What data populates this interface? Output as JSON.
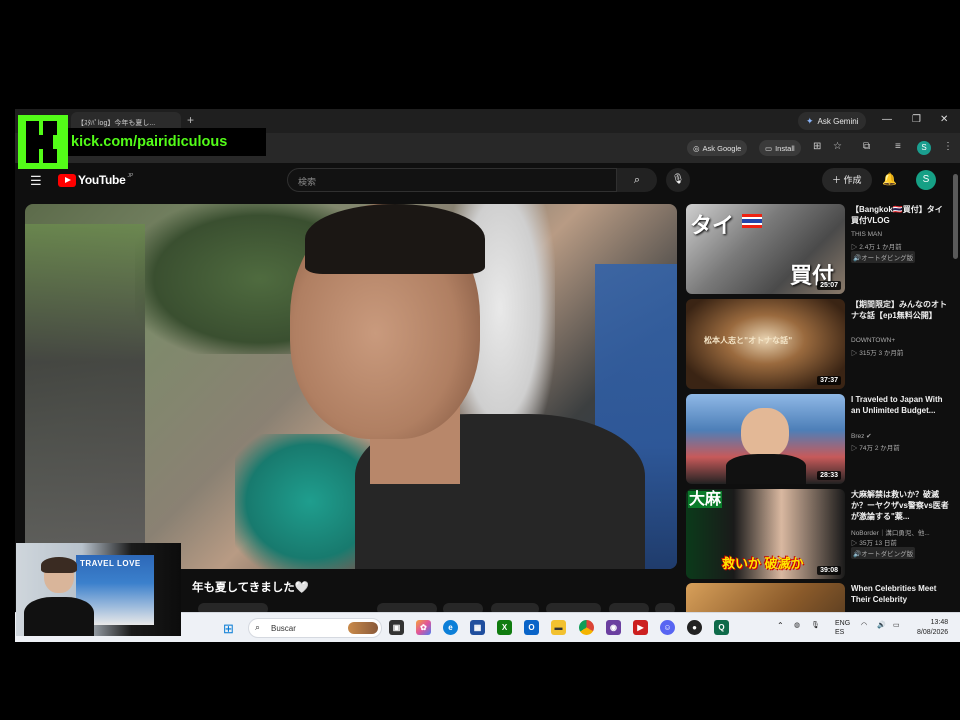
{
  "browser": {
    "tab_title": "【ｽﾀﾊﾟlog】今年も夏し...",
    "new_tab": "+",
    "ask_gemini": "Ask Gemini",
    "ask_google": "Ask Google",
    "install": "Install",
    "profile_initial": "S"
  },
  "overlay": {
    "kick_text": "kick.com/pairidiculous"
  },
  "youtube": {
    "logo": "YouTube",
    "logo_sup": "JP",
    "search_placeholder": "検索",
    "create_label": "作成",
    "avatar_initial": "S"
  },
  "video": {
    "caption": "年も夏してきました🤍"
  },
  "cam": {
    "poster_text": "TRAVEL LOVE"
  },
  "recommendations": [
    {
      "title": "【Bangkok🇹🇭買付】タイ買付VLOG",
      "channel": "THIS MAN",
      "meta": "▷ 2.4万  1 か月前",
      "badge": "🔊オートダビング版",
      "duration": "25:07",
      "thumb_left": "タイ",
      "thumb_right": "買付",
      "thumb_bg": "#6e6e6e"
    },
    {
      "title": "【期間限定】みんなのオトナな話【ep1無料公開】",
      "channel": "DOWNTOWN+",
      "meta": "▷ 315万  3 か月前",
      "badge": "",
      "duration": "37:37",
      "thumb_left": "松本人志と\"オトナな話\"",
      "thumb_right": "",
      "thumb_bg": "#7a4a2a"
    },
    {
      "title": "I Traveled to Japan With an Unlimited Budget...",
      "channel": "Brez ✔",
      "meta": "▷ 74万  2 か月前",
      "badge": "",
      "duration": "28:33",
      "thumb_left": "",
      "thumb_right": "",
      "thumb_bg": "#4d7fb8"
    },
    {
      "title": "大麻解禁は救いか？破滅か？ーヤクザvs警察vs医者が激論する\"薬...",
      "channel": "NoBorder｜溝口勇児、他...",
      "meta": "▷ 35万  13 日前",
      "badge": "🔊オートダビング版",
      "duration": "39:08",
      "thumb_left": "大麻",
      "thumb_right": "救いか 破滅か",
      "thumb_bg": "#1a1a1a"
    },
    {
      "title": "When Celebrities Meet Their Celebrity",
      "channel": "",
      "meta": "",
      "badge": "",
      "duration": "",
      "thumb_left": "",
      "thumb_right": "",
      "thumb_bg": "#b07a3a"
    }
  ],
  "taskbar": {
    "search_label": "Buscar",
    "lang_top": "ENG",
    "lang_bottom": "ES",
    "time": "13:48",
    "date": "8/08/2026"
  }
}
